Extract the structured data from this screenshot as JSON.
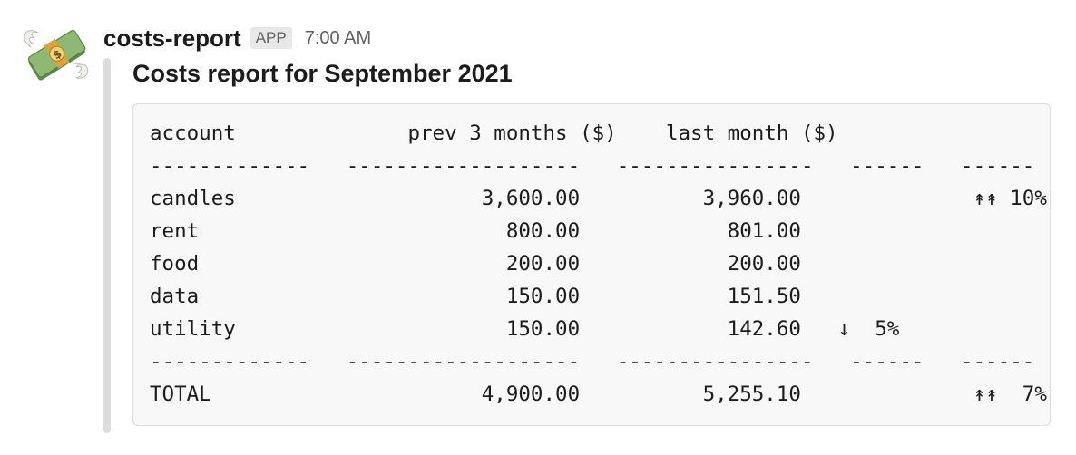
{
  "message": {
    "sender": "costs-report",
    "badge": "APP",
    "timestamp": "7:00 AM",
    "avatar_icon": "money-with-wings-icon",
    "title": "Costs report for September 2021"
  },
  "report": {
    "lines": [
      "account              prev 3 months ($)    last month ($)",
      "-------------   -------------------   ----------------   ------   ------",
      "candles                    3,600.00          3,960.00              ↟↟ 10%",
      "rent                         800.00            801.00",
      "food                         200.00            200.00",
      "data                         150.00            151.50",
      "utility                      150.00            142.60   ↓  5%",
      "-------------   -------------------   ----------------   ------   ------",
      "TOTAL                      4,900.00          5,255.10              ↟↟  7%"
    ]
  },
  "colors": {
    "bar": "#dddddd",
    "code_bg": "#f8f8f8",
    "code_border": "#dcdcdc",
    "badge_bg": "#e8e8e8"
  }
}
